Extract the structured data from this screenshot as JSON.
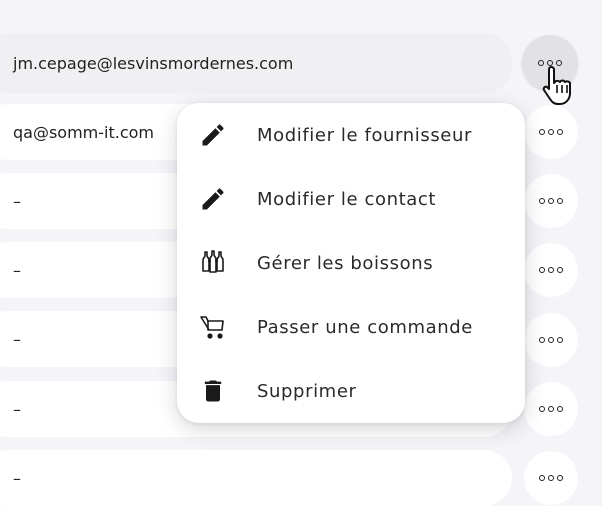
{
  "rows": [
    {
      "contact": "jm.cepage@lesvinsmordernes.com"
    },
    {
      "contact": "qa@somm-it.com"
    },
    {
      "contact": "–"
    },
    {
      "contact": "–"
    },
    {
      "contact": "–"
    },
    {
      "contact": "–"
    },
    {
      "contact": "–"
    }
  ],
  "menu": {
    "items": [
      {
        "label": "Modifier le fournisseur",
        "icon": "pencil-icon"
      },
      {
        "label": "Modifier le contact",
        "icon": "pencil-icon"
      },
      {
        "label": "Gérer les boissons",
        "icon": "bottles-icon"
      },
      {
        "label": "Passer une commande",
        "icon": "cart-icon"
      },
      {
        "label": "Supprimer",
        "icon": "trash-icon"
      }
    ]
  }
}
